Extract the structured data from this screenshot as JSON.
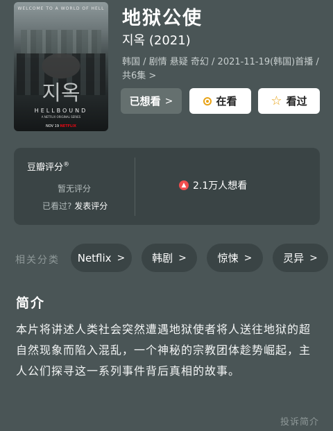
{
  "poster": {
    "tagline": "WELCOME TO A WORLD OF HELL",
    "korean_title": "지옥",
    "english_title": "HELLBOUND",
    "subtitle": "A NETFLIX ORIGINAL SERIES",
    "release_date": "NOV 19",
    "release_brand": "NETFLIX"
  },
  "title": "地狱公使",
  "original_title": "지옥 (2021)",
  "meta": "韩国 / 剧情 悬疑 奇幻 / 2021-11-19(韩国)首播 / 共6集 >",
  "buttons": {
    "wished": "已想看",
    "watching": "在看",
    "watched": "看过"
  },
  "rating": {
    "label": "豆瓣评分",
    "label_mark": "®",
    "no_rating": "暂无评分",
    "seen_prompt": "已看过?",
    "post_review": "发表评分",
    "wish_count": "2.1万人想看"
  },
  "categories": {
    "label": "相关分类",
    "items": [
      "Netflix",
      "韩剧",
      "惊悚",
      "灵异"
    ]
  },
  "intro": {
    "heading": "简介",
    "text": "本片将讲述人类社会突然遭遇地狱使者将人送往地狱的超自然现象而陷入混乱，一个神秘的宗教团体趁势崛起，主人公们探寻这一系列事件背后真相的故事。",
    "report_label": "投诉简介"
  }
}
